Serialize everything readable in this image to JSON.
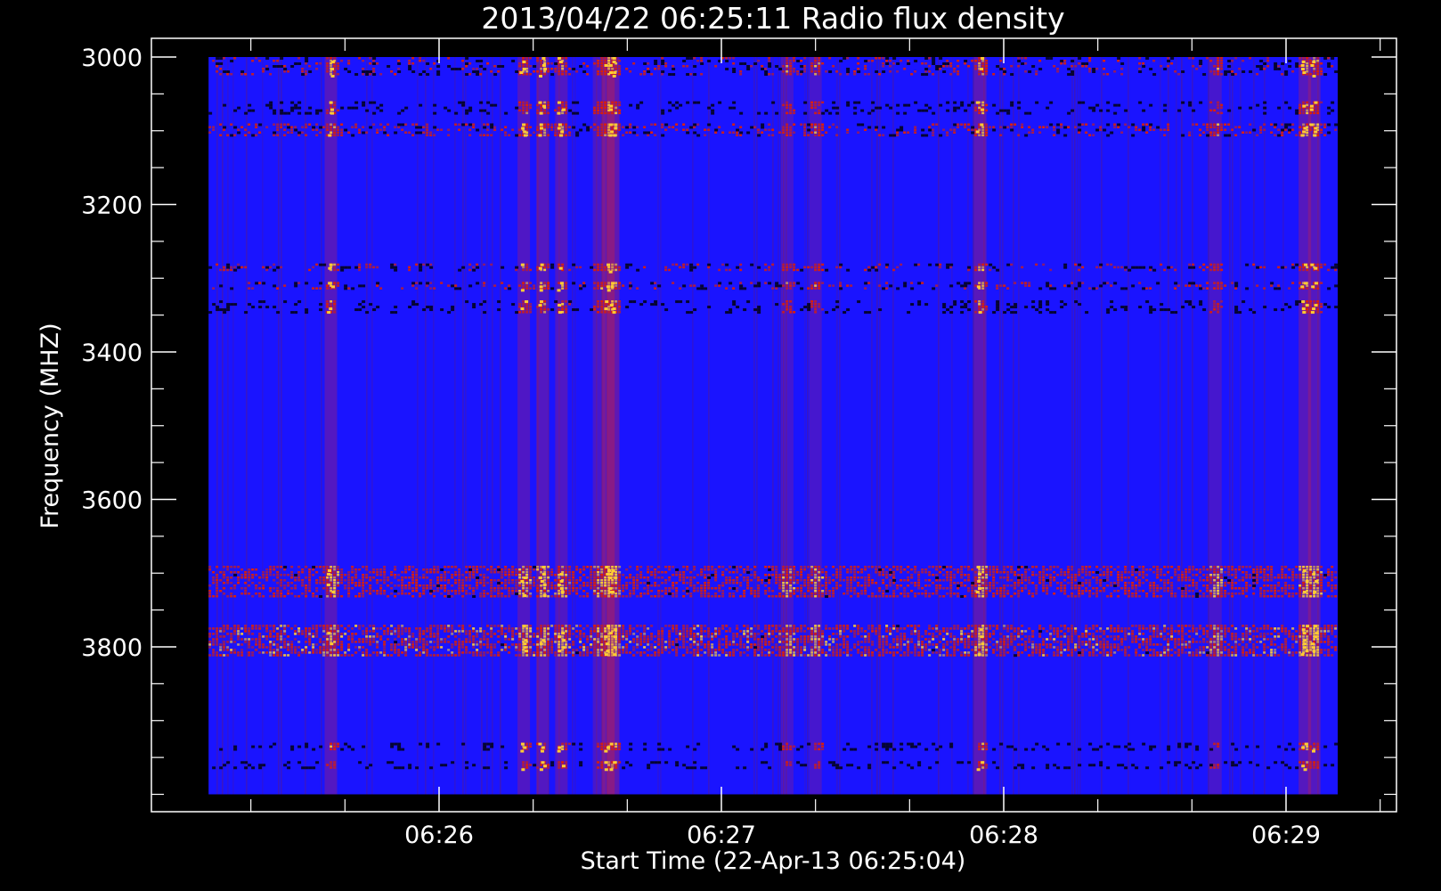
{
  "chart_data": {
    "type": "heatmap",
    "title": "2013/04/22 06:25:11 Radio flux density",
    "xlabel": "Start Time (22-Apr-13 06:25:04)",
    "ylabel": "Frequency (MHZ)",
    "x_tick_labels": [
      "06:26",
      "06:27",
      "06:28",
      "06:29"
    ],
    "y_tick_labels": [
      "3000",
      "3200",
      "3400",
      "3600",
      "3800"
    ],
    "y_ticks_mhz": [
      3000,
      3200,
      3400,
      3600,
      3800
    ],
    "ylim": [
      2950,
      4000
    ],
    "y_axis_inverted": true,
    "x_major_ticks": [
      "06:26",
      "06:27",
      "06:28",
      "06:29"
    ],
    "data_extent": {
      "time_start": "06:25:11",
      "time_end": "06:29:11",
      "freq_start_mhz": 3000,
      "freq_end_mhz": 4000
    },
    "colormap": [
      "#000000",
      "#1a14ff",
      "#e02000",
      "#ffcc33"
    ],
    "background_level_color": "#1a14ff",
    "emission_bands_mhz": [
      {
        "from": 3000,
        "to": 3025,
        "level": 0.55
      },
      {
        "from": 3060,
        "to": 3075,
        "level": 0.5
      },
      {
        "from": 3090,
        "to": 3105,
        "level": 0.6
      },
      {
        "from": 3280,
        "to": 3290,
        "level": 0.55
      },
      {
        "from": 3305,
        "to": 3315,
        "level": 0.55
      },
      {
        "from": 3330,
        "to": 3345,
        "level": 0.5
      },
      {
        "from": 3690,
        "to": 3730,
        "level": 0.8
      },
      {
        "from": 3770,
        "to": 3810,
        "level": 0.85
      },
      {
        "from": 3930,
        "to": 3940,
        "level": 0.5
      },
      {
        "from": 3955,
        "to": 3965,
        "level": 0.45
      }
    ],
    "bursts": [
      {
        "time": "06:25:37",
        "level": 0.75
      },
      {
        "time": "06:26:18",
        "level": 0.7
      },
      {
        "time": "06:26:22",
        "level": 0.75
      },
      {
        "time": "06:26:26",
        "level": 0.7
      },
      {
        "time": "06:26:34",
        "level": 0.6
      },
      {
        "time": "06:26:36",
        "level": 0.95
      },
      {
        "time": "06:26:37",
        "level": 0.9
      },
      {
        "time": "06:27:14",
        "level": 0.55
      },
      {
        "time": "06:27:20",
        "level": 0.6
      },
      {
        "time": "06:27:55",
        "level": 0.85
      },
      {
        "time": "06:28:45",
        "level": 0.6
      },
      {
        "time": "06:29:04",
        "level": 0.8
      },
      {
        "time": "06:29:06",
        "level": 0.75
      }
    ]
  }
}
